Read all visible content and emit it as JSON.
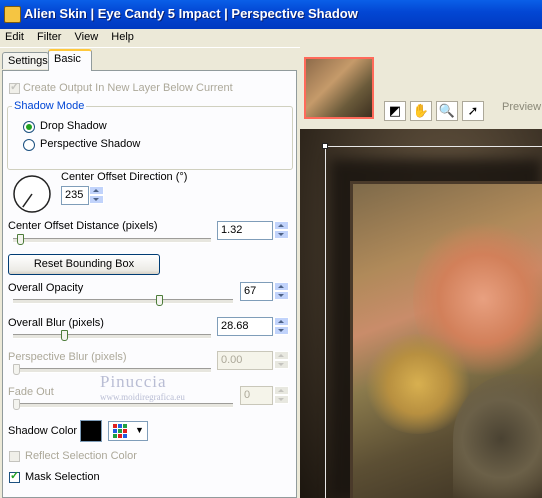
{
  "window": {
    "title": "Alien Skin | Eye Candy 5 Impact | Perspective Shadow"
  },
  "menu": [
    "Edit",
    "Filter",
    "View",
    "Help"
  ],
  "tabs": {
    "settings": "Settings",
    "basic": "Basic"
  },
  "options": {
    "create_output_label": "Create Output In New Layer Below Current",
    "create_output_checked": true
  },
  "shadow_mode": {
    "title": "Shadow Mode",
    "drop_shadow": "Drop Shadow",
    "perspective_shadow": "Perspective Shadow",
    "selected": "Drop Shadow"
  },
  "direction": {
    "label": "Center Offset Direction (°)",
    "value": "235"
  },
  "offset_distance": {
    "label": "Center Offset Distance (pixels)",
    "value": "1.32",
    "slider_fraction": 0.02
  },
  "reset_button": "Reset Bounding Box",
  "opacity": {
    "label": "Overall Opacity",
    "value": "67",
    "slider_fraction": 0.67
  },
  "blur": {
    "label": "Overall Blur (pixels)",
    "value": "28.68",
    "slider_fraction": 0.25
  },
  "perspective_blur": {
    "label": "Perspective Blur (pixels)",
    "value": "0.00",
    "slider_fraction": 0.0
  },
  "fade_out": {
    "label": "Fade Out",
    "value": "0",
    "slider_fraction": 0.0
  },
  "shadow_color": {
    "label": "Shadow Color",
    "color": "#000000"
  },
  "reflect_selection": {
    "label": "Reflect Selection Color",
    "checked": false
  },
  "mask_selection": {
    "label": "Mask Selection",
    "checked": true
  },
  "preview": {
    "label": "Preview"
  },
  "watermark": {
    "name": "Pinuccia",
    "site": "www.moidiregrafica.eu"
  },
  "colors": {
    "accent": "#0046d5",
    "titlebar": "#0347d4",
    "tab_highlight": "#ffc83c",
    "thumb_border": "#ff6a5a"
  }
}
